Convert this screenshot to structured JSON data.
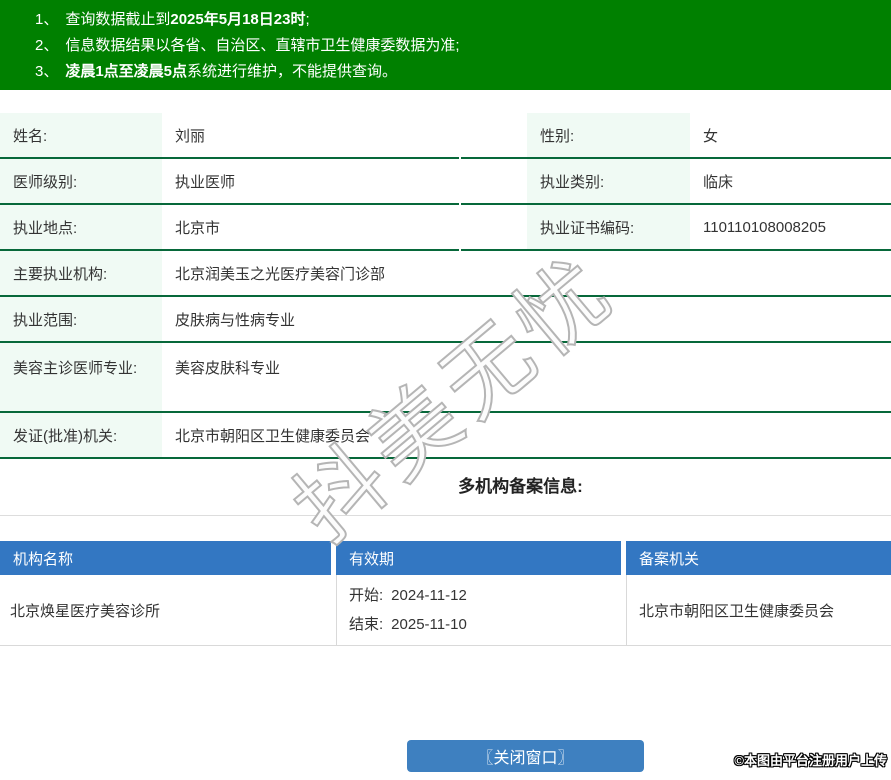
{
  "colors": {
    "banner_bg": "#008000",
    "row_border": "#07683a",
    "label_bg": "#f0faf4",
    "table_header_bg": "#3377c2",
    "button_bg": "#3e80c0",
    "divider": "#dddddd",
    "body_border": "#d9d9d9",
    "text": "#333333"
  },
  "notice": {
    "items": [
      {
        "num": "1、",
        "pre": "查询数据截止到",
        "bold": "2025年5月18日23时",
        "post": ";"
      },
      {
        "num": "2、",
        "pre": "信息数据结果以各省、自治区、直辖市卫生健康委数据为准;",
        "bold": "",
        "post": ""
      },
      {
        "num": "3、",
        "pre": "",
        "bold": "凌晨1点至凌晨5点",
        "post": "系统进行维护，不能提供查询。"
      }
    ]
  },
  "info": {
    "rows": [
      {
        "label1": "姓名:",
        "value1": "刘丽",
        "label2": "性别:",
        "value2": "女"
      },
      {
        "label1": "医师级别:",
        "value1": "执业医师",
        "label2": "执业类别:",
        "value2": "临床"
      },
      {
        "label1": "执业地点:",
        "value1": "北京市",
        "label2": "执业证书编码:",
        "value2": "110110108008205"
      },
      {
        "label1": "主要执业机构:",
        "value1": "北京润美玉之光医疗美容门诊部"
      },
      {
        "label1": "执业范围:",
        "value1": "皮肤病与性病专业"
      },
      {
        "label1": "美容主诊医师专业:",
        "value1": "美容皮肤科专业"
      },
      {
        "label1": "发证(批准)机关:",
        "value1": "北京市朝阳区卫生健康委员会"
      }
    ]
  },
  "filing": {
    "heading": "多机构备案信息:",
    "headers": [
      "机构名称",
      "有效期",
      "备案机关"
    ],
    "rows": [
      {
        "name": "北京焕星医疗美容诊所",
        "start_label": "开始:",
        "start_date": "2024-11-12",
        "end_label": "结束:",
        "end_date": "2025-11-10",
        "authority": "北京市朝阳区卫生健康委员会"
      }
    ]
  },
  "button": {
    "close_label": "〖关闭窗口〗"
  },
  "watermark": {
    "text": "抖美无忧"
  },
  "footer": {
    "credit": "©本图由平台注册用户上传"
  }
}
